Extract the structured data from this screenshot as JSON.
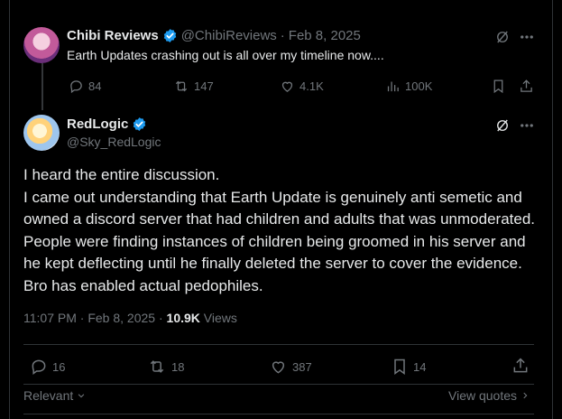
{
  "reply_to": {
    "name": "Chibi Reviews",
    "handle": "@ChibiReviews",
    "separator": "·",
    "date": "Feb 8, 2025",
    "text": "Earth Updates crashing out is all over my timeline now....",
    "stats": {
      "replies": "84",
      "reposts": "147",
      "likes": "4.1K",
      "views": "100K"
    }
  },
  "post": {
    "name": "RedLogic",
    "handle": "@Sky_RedLogic",
    "body": "I heard the entire discussion.\nI came out understanding that Earth Update is genuinely anti semetic and owned a discord server that had children and adults that was unmoderated. People were finding instances of children being groomed in his server and he kept deflecting until he finally deleted the server to cover the evidence. Bro has enabled actual pedophiles.",
    "time": "11:07 PM",
    "date": "Feb 8, 2025",
    "separator": "·",
    "view_count": "10.9K",
    "views_label": "Views",
    "stats": {
      "replies": "16",
      "reposts": "18",
      "likes": "387",
      "bookmarks": "14"
    }
  },
  "footer": {
    "sort_label": "Relevant",
    "view_quotes_label": "View quotes"
  },
  "colors": {
    "background": "#000000",
    "text": "#e7e9ea",
    "muted": "#71767b",
    "verified": "#1d9bf0",
    "border": "#2f3336"
  }
}
